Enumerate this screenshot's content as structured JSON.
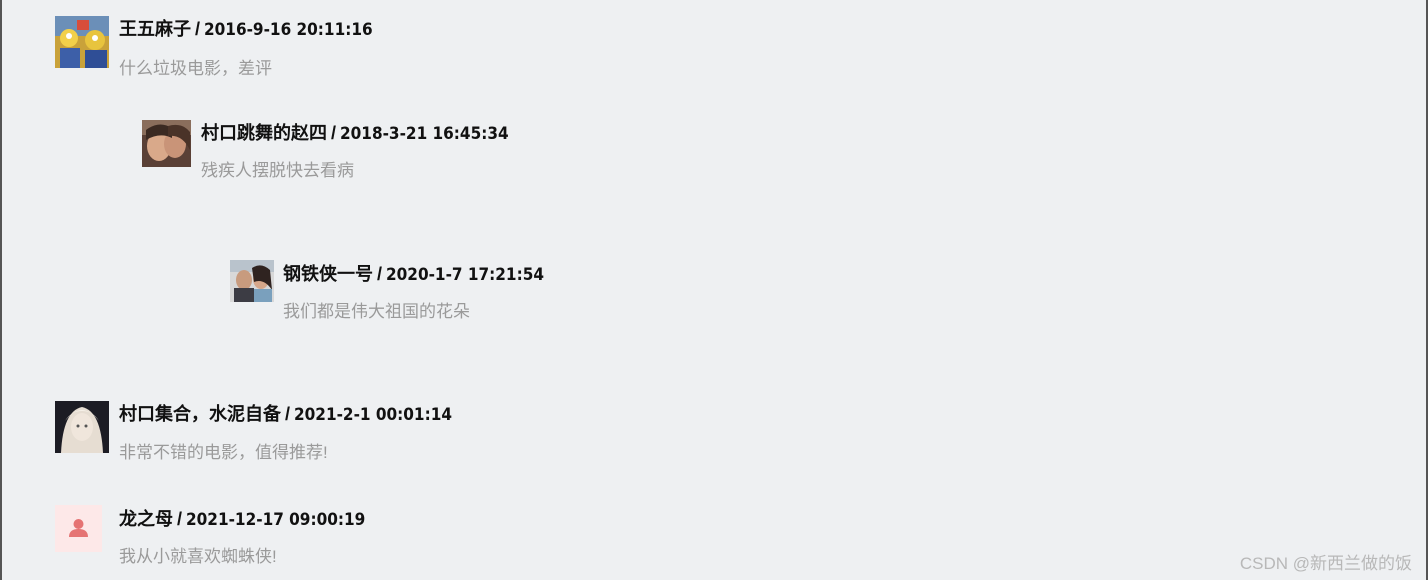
{
  "comments": [
    {
      "username": "王五麻子",
      "separator": "/",
      "time": "2016-9-16 20:11:16",
      "content": "什么垃圾电影，差评"
    },
    {
      "username": "村口跳舞的赵四",
      "separator": "/",
      "time": "2018-3-21 16:45:34",
      "content": "残疾人摆脱快去看病"
    },
    {
      "username": "钢铁侠一号",
      "separator": "/",
      "time": "2020-1-7 17:21:54",
      "content": "我们都是伟大祖国的花朵"
    },
    {
      "username": "村口集合，水泥自备",
      "separator": "/",
      "time": "2021-2-1 00:01:14",
      "content": "非常不错的电影，值得推荐!"
    },
    {
      "username": "龙之母",
      "separator": "/",
      "time": "2021-12-17 09:00:19",
      "content": "我从小就喜欢蜘蛛侠!"
    }
  ],
  "watermark": "CSDN @新西兰做的饭",
  "colors": {
    "background": "#eef0f2",
    "username": "#111111",
    "content": "#9a9a9a",
    "watermark": "#b8b8b8",
    "default_avatar_bg": "#fde8e8",
    "default_avatar_fg": "#e57373"
  }
}
